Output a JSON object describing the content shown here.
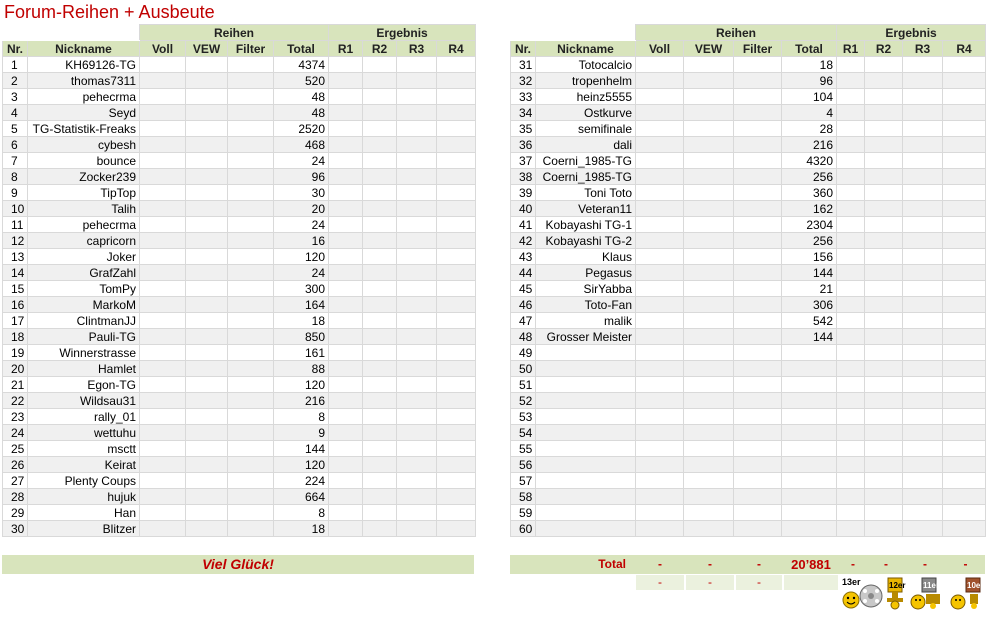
{
  "title": "Forum-Reihen + Ausbeute",
  "headers": {
    "nr": "Nr.",
    "nickname": "Nickname",
    "reihen": "Reihen",
    "ergebnis": "Ergebnis",
    "voll": "Voll",
    "vew": "VEW",
    "filter": "Filter",
    "total": "Total",
    "r1": "R1",
    "r2": "R2",
    "r3": "R3",
    "r4": "R4"
  },
  "left_rows": [
    {
      "nr": "1",
      "nick": "KH69126-TG",
      "total": "4374"
    },
    {
      "nr": "2",
      "nick": "thomas7311",
      "total": "520"
    },
    {
      "nr": "3",
      "nick": "pehecrma",
      "total": "48"
    },
    {
      "nr": "4",
      "nick": "Seyd",
      "total": "48"
    },
    {
      "nr": "5",
      "nick": "TG-Statistik-Freaks",
      "total": "2520"
    },
    {
      "nr": "6",
      "nick": "cybesh",
      "total": "468"
    },
    {
      "nr": "7",
      "nick": "bounce",
      "total": "24"
    },
    {
      "nr": "8",
      "nick": "Zocker239",
      "total": "96"
    },
    {
      "nr": "9",
      "nick": "TipTop",
      "total": "30"
    },
    {
      "nr": "10",
      "nick": "Talih",
      "total": "20"
    },
    {
      "nr": "11",
      "nick": "pehecrma",
      "total": "24"
    },
    {
      "nr": "12",
      "nick": "capricorn",
      "total": "16"
    },
    {
      "nr": "13",
      "nick": "Joker",
      "total": "120"
    },
    {
      "nr": "14",
      "nick": "GrafZahl",
      "total": "24"
    },
    {
      "nr": "15",
      "nick": "TomPy",
      "total": "300"
    },
    {
      "nr": "16",
      "nick": "MarkoM",
      "total": "164"
    },
    {
      "nr": "17",
      "nick": "ClintmanJJ",
      "total": "18"
    },
    {
      "nr": "18",
      "nick": "Pauli-TG",
      "total": "850"
    },
    {
      "nr": "19",
      "nick": "Winnerstrasse",
      "total": "161"
    },
    {
      "nr": "20",
      "nick": "Hamlet",
      "total": "88"
    },
    {
      "nr": "21",
      "nick": "Egon-TG",
      "total": "120"
    },
    {
      "nr": "22",
      "nick": "Wildsau31",
      "total": "216"
    },
    {
      "nr": "23",
      "nick": "rally_01",
      "total": "8"
    },
    {
      "nr": "24",
      "nick": "wettuhu",
      "total": "9"
    },
    {
      "nr": "25",
      "nick": "msctt",
      "total": "144"
    },
    {
      "nr": "26",
      "nick": "Keirat",
      "total": "120"
    },
    {
      "nr": "27",
      "nick": "Plenty Coups",
      "total": "224"
    },
    {
      "nr": "28",
      "nick": "hujuk",
      "total": "664"
    },
    {
      "nr": "29",
      "nick": "Han",
      "total": "8"
    },
    {
      "nr": "30",
      "nick": "Blitzer",
      "total": "18"
    }
  ],
  "right_rows": [
    {
      "nr": "31",
      "nick": "Totocalcio",
      "total": "18"
    },
    {
      "nr": "32",
      "nick": "tropenhelm",
      "total": "96"
    },
    {
      "nr": "33",
      "nick": "heinz5555",
      "total": "104"
    },
    {
      "nr": "34",
      "nick": "Ostkurve",
      "total": "4"
    },
    {
      "nr": "35",
      "nick": "semifinale",
      "total": "28"
    },
    {
      "nr": "36",
      "nick": "dali",
      "total": "216"
    },
    {
      "nr": "37",
      "nick": "Coerni_1985-TG",
      "total": "4320"
    },
    {
      "nr": "38",
      "nick": "Coerni_1985-TG",
      "total": "256"
    },
    {
      "nr": "39",
      "nick": "Toni Toto",
      "total": "360"
    },
    {
      "nr": "40",
      "nick": "Veteran11",
      "total": "162"
    },
    {
      "nr": "41",
      "nick": "Kobayashi TG-1",
      "total": "2304"
    },
    {
      "nr": "42",
      "nick": "Kobayashi TG-2",
      "total": "256"
    },
    {
      "nr": "43",
      "nick": "Klaus",
      "total": "156"
    },
    {
      "nr": "44",
      "nick": "Pegasus",
      "total": "144"
    },
    {
      "nr": "45",
      "nick": "SirYabba",
      "total": "21"
    },
    {
      "nr": "46",
      "nick": "Toto-Fan",
      "total": "306"
    },
    {
      "nr": "47",
      "nick": "malik",
      "total": "542"
    },
    {
      "nr": "48",
      "nick": "Grosser Meister",
      "total": "144"
    },
    {
      "nr": "49",
      "nick": "",
      "total": ""
    },
    {
      "nr": "50",
      "nick": "",
      "total": ""
    },
    {
      "nr": "51",
      "nick": "",
      "total": ""
    },
    {
      "nr": "52",
      "nick": "",
      "total": ""
    },
    {
      "nr": "53",
      "nick": "",
      "total": ""
    },
    {
      "nr": "54",
      "nick": "",
      "total": ""
    },
    {
      "nr": "55",
      "nick": "",
      "total": ""
    },
    {
      "nr": "56",
      "nick": "",
      "total": ""
    },
    {
      "nr": "57",
      "nick": "",
      "total": ""
    },
    {
      "nr": "58",
      "nick": "",
      "total": ""
    },
    {
      "nr": "59",
      "nick": "",
      "total": ""
    },
    {
      "nr": "60",
      "nick": "",
      "total": ""
    }
  ],
  "footer": {
    "good_luck": "Viel Glück!",
    "total_label": "Total",
    "voll": "-",
    "vew": "-",
    "filter": "-",
    "total": "20’881",
    "r1": "-",
    "r2": "-",
    "r3": "-",
    "r4": "-",
    "sub_voll": "-",
    "sub_vew": "-",
    "sub_filter": "-"
  },
  "badges": {
    "b1": "13er",
    "b2": "12er",
    "b3": "11er",
    "b4": "10er"
  },
  "colors": {
    "header_bg": "#d8e4bc",
    "title": "#c00000",
    "alt_row": "#f0f0f0"
  }
}
